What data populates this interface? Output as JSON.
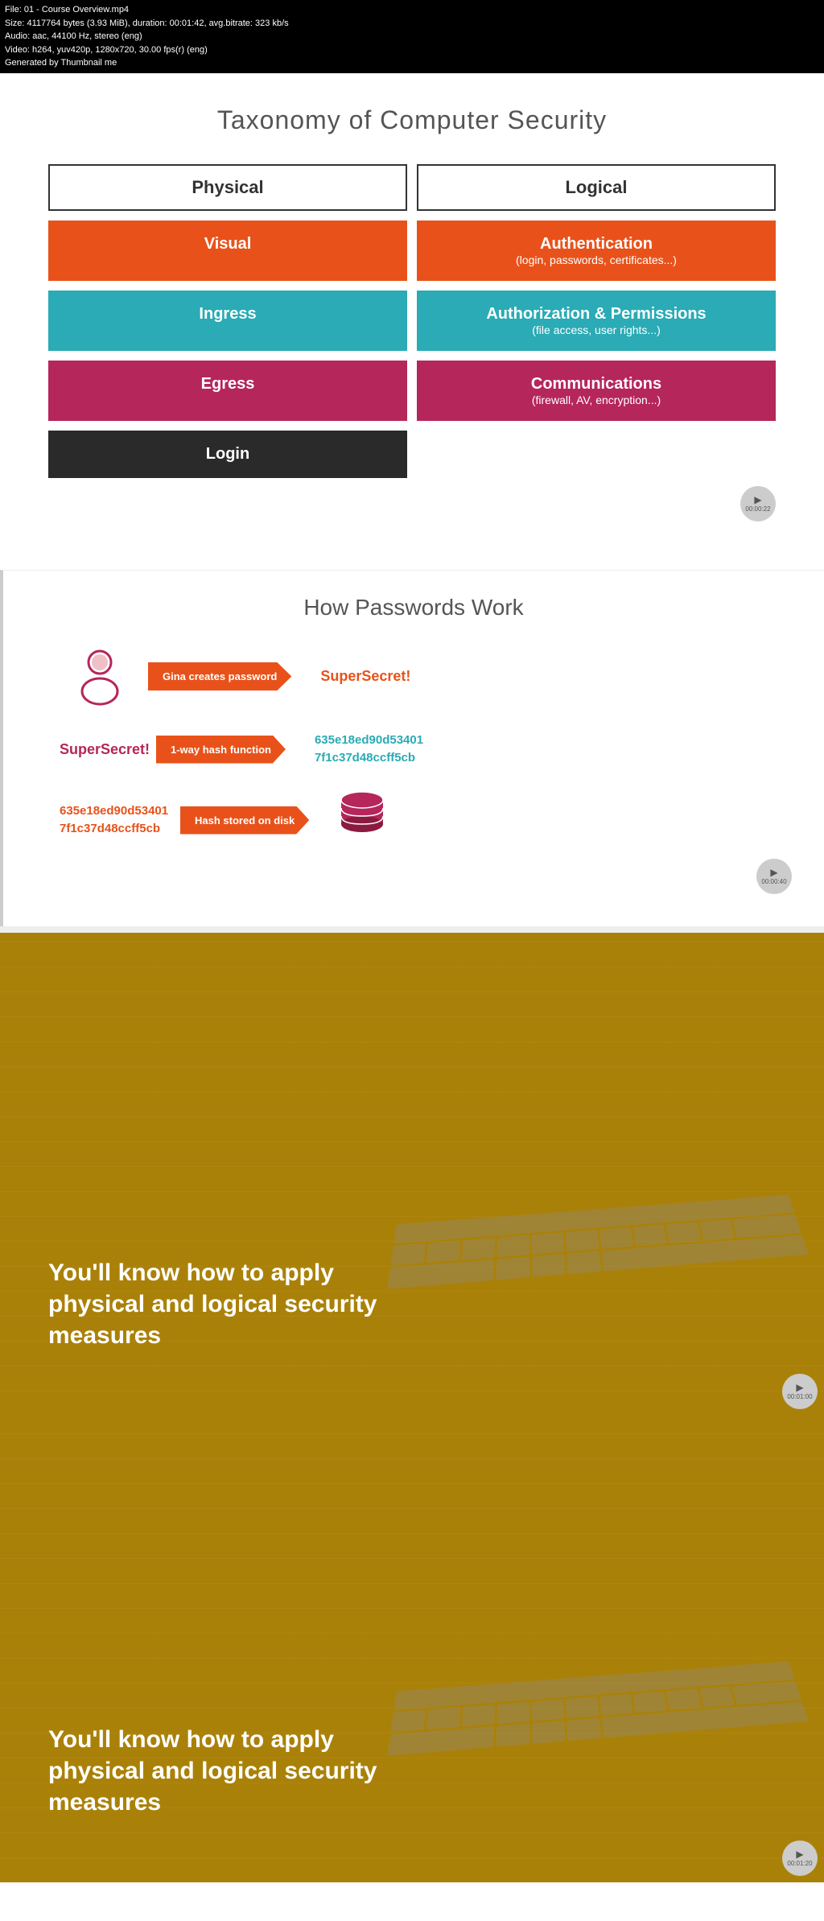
{
  "meta": {
    "line1": "File: 01 - Course Overview.mp4",
    "line2": "Size: 4117764 bytes (3.93 MiB), duration: 00:01:42, avg.bitrate: 323 kb/s",
    "line3": "Audio: aac, 44100 Hz, stereo (eng)",
    "line4": "Video: h264, yuv420p, 1280x720, 30.00 fps(r) (eng)",
    "line5": "Generated by Thumbnail me"
  },
  "slide1": {
    "title": "Taxonomy of Computer Security",
    "col1_header": "Physical",
    "col2_header": "Logical",
    "physical_items": [
      {
        "id": "visual",
        "label": "Visual"
      },
      {
        "id": "ingress",
        "label": "Ingress"
      },
      {
        "id": "egress",
        "label": "Egress"
      },
      {
        "id": "login",
        "label": "Login"
      }
    ],
    "logical_items": [
      {
        "id": "auth",
        "label": "Authentication",
        "sub": "(login, passwords, certificates...)"
      },
      {
        "id": "authz",
        "label": "Authorization & Permissions",
        "sub": "(file access, user rights...)"
      },
      {
        "id": "comms",
        "label": "Communications",
        "sub": "(firewall, AV, encryption...)"
      }
    ],
    "timestamp": "00:00:22"
  },
  "slide2": {
    "title": "How Passwords Work",
    "gina_label": "Gina",
    "arrow1": "Gina creates password",
    "result1": "SuperSecret!",
    "password_label": "SuperSecret!",
    "arrow2": "1-way hash function",
    "hash1": "635e18ed90d53401\n7f1c37d48ccff5cb",
    "hash_left": "635e18ed90d53401\n7f1c37d48ccff5cb",
    "arrow3": "Hash stored on disk",
    "timestamp": "00:00:40"
  },
  "slide3": {
    "text": "You'll know how to apply physical and logical security measures",
    "timestamp": "00:01:00"
  },
  "slide4": {
    "text": "You'll know how to apply physical and logical security measures",
    "timestamp": "00:01:20"
  }
}
